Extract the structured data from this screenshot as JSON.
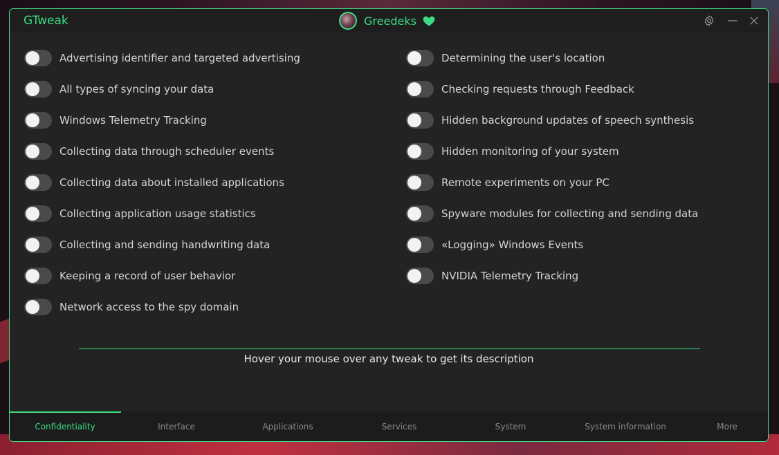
{
  "app": {
    "title": "GTweak"
  },
  "profile": {
    "username": "Greedeks"
  },
  "left_tweaks": [
    {
      "label": "Advertising identifier and targeted advertising",
      "enabled": false
    },
    {
      "label": "All types of syncing your data",
      "enabled": false
    },
    {
      "label": "Windows Telemetry Tracking",
      "enabled": false
    },
    {
      "label": "Collecting data through scheduler events",
      "enabled": false
    },
    {
      "label": "Collecting data about installed applications",
      "enabled": false
    },
    {
      "label": "Collecting application usage statistics",
      "enabled": false
    },
    {
      "label": "Collecting and sending handwriting data",
      "enabled": false
    },
    {
      "label": "Keeping a record of user behavior",
      "enabled": false
    },
    {
      "label": "Network access to the spy domain",
      "enabled": false
    }
  ],
  "right_tweaks": [
    {
      "label": "Determining the user's location",
      "enabled": false
    },
    {
      "label": "Checking requests through Feedback",
      "enabled": false
    },
    {
      "label": "Hidden background updates of speech synthesis",
      "enabled": false
    },
    {
      "label": "Hidden monitoring of your system",
      "enabled": false
    },
    {
      "label": "Remote experiments on your PC",
      "enabled": false
    },
    {
      "label": "Spyware modules for collecting and sending data",
      "enabled": false
    },
    {
      "label": "«Logging» Windows Events",
      "enabled": false
    },
    {
      "label": "NVIDIA Telemetry Tracking",
      "enabled": false
    }
  ],
  "hint": "Hover your mouse over any tweak to get its description",
  "tabs": [
    {
      "label": "Confidentiality",
      "active": true
    },
    {
      "label": "Interface",
      "active": false
    },
    {
      "label": "Applications",
      "active": false
    },
    {
      "label": "Services",
      "active": false
    },
    {
      "label": "System",
      "active": false
    },
    {
      "label": "System information",
      "active": false
    },
    {
      "label": "More",
      "active": false
    }
  ],
  "colors": {
    "accent": "#3ddc84",
    "window_bg": "#232323",
    "toggle_off": "#4a4a4a"
  },
  "icons": {
    "settings": "gear-icon",
    "minimize": "minimize-icon",
    "close": "close-icon",
    "heart": "heart-icon"
  }
}
